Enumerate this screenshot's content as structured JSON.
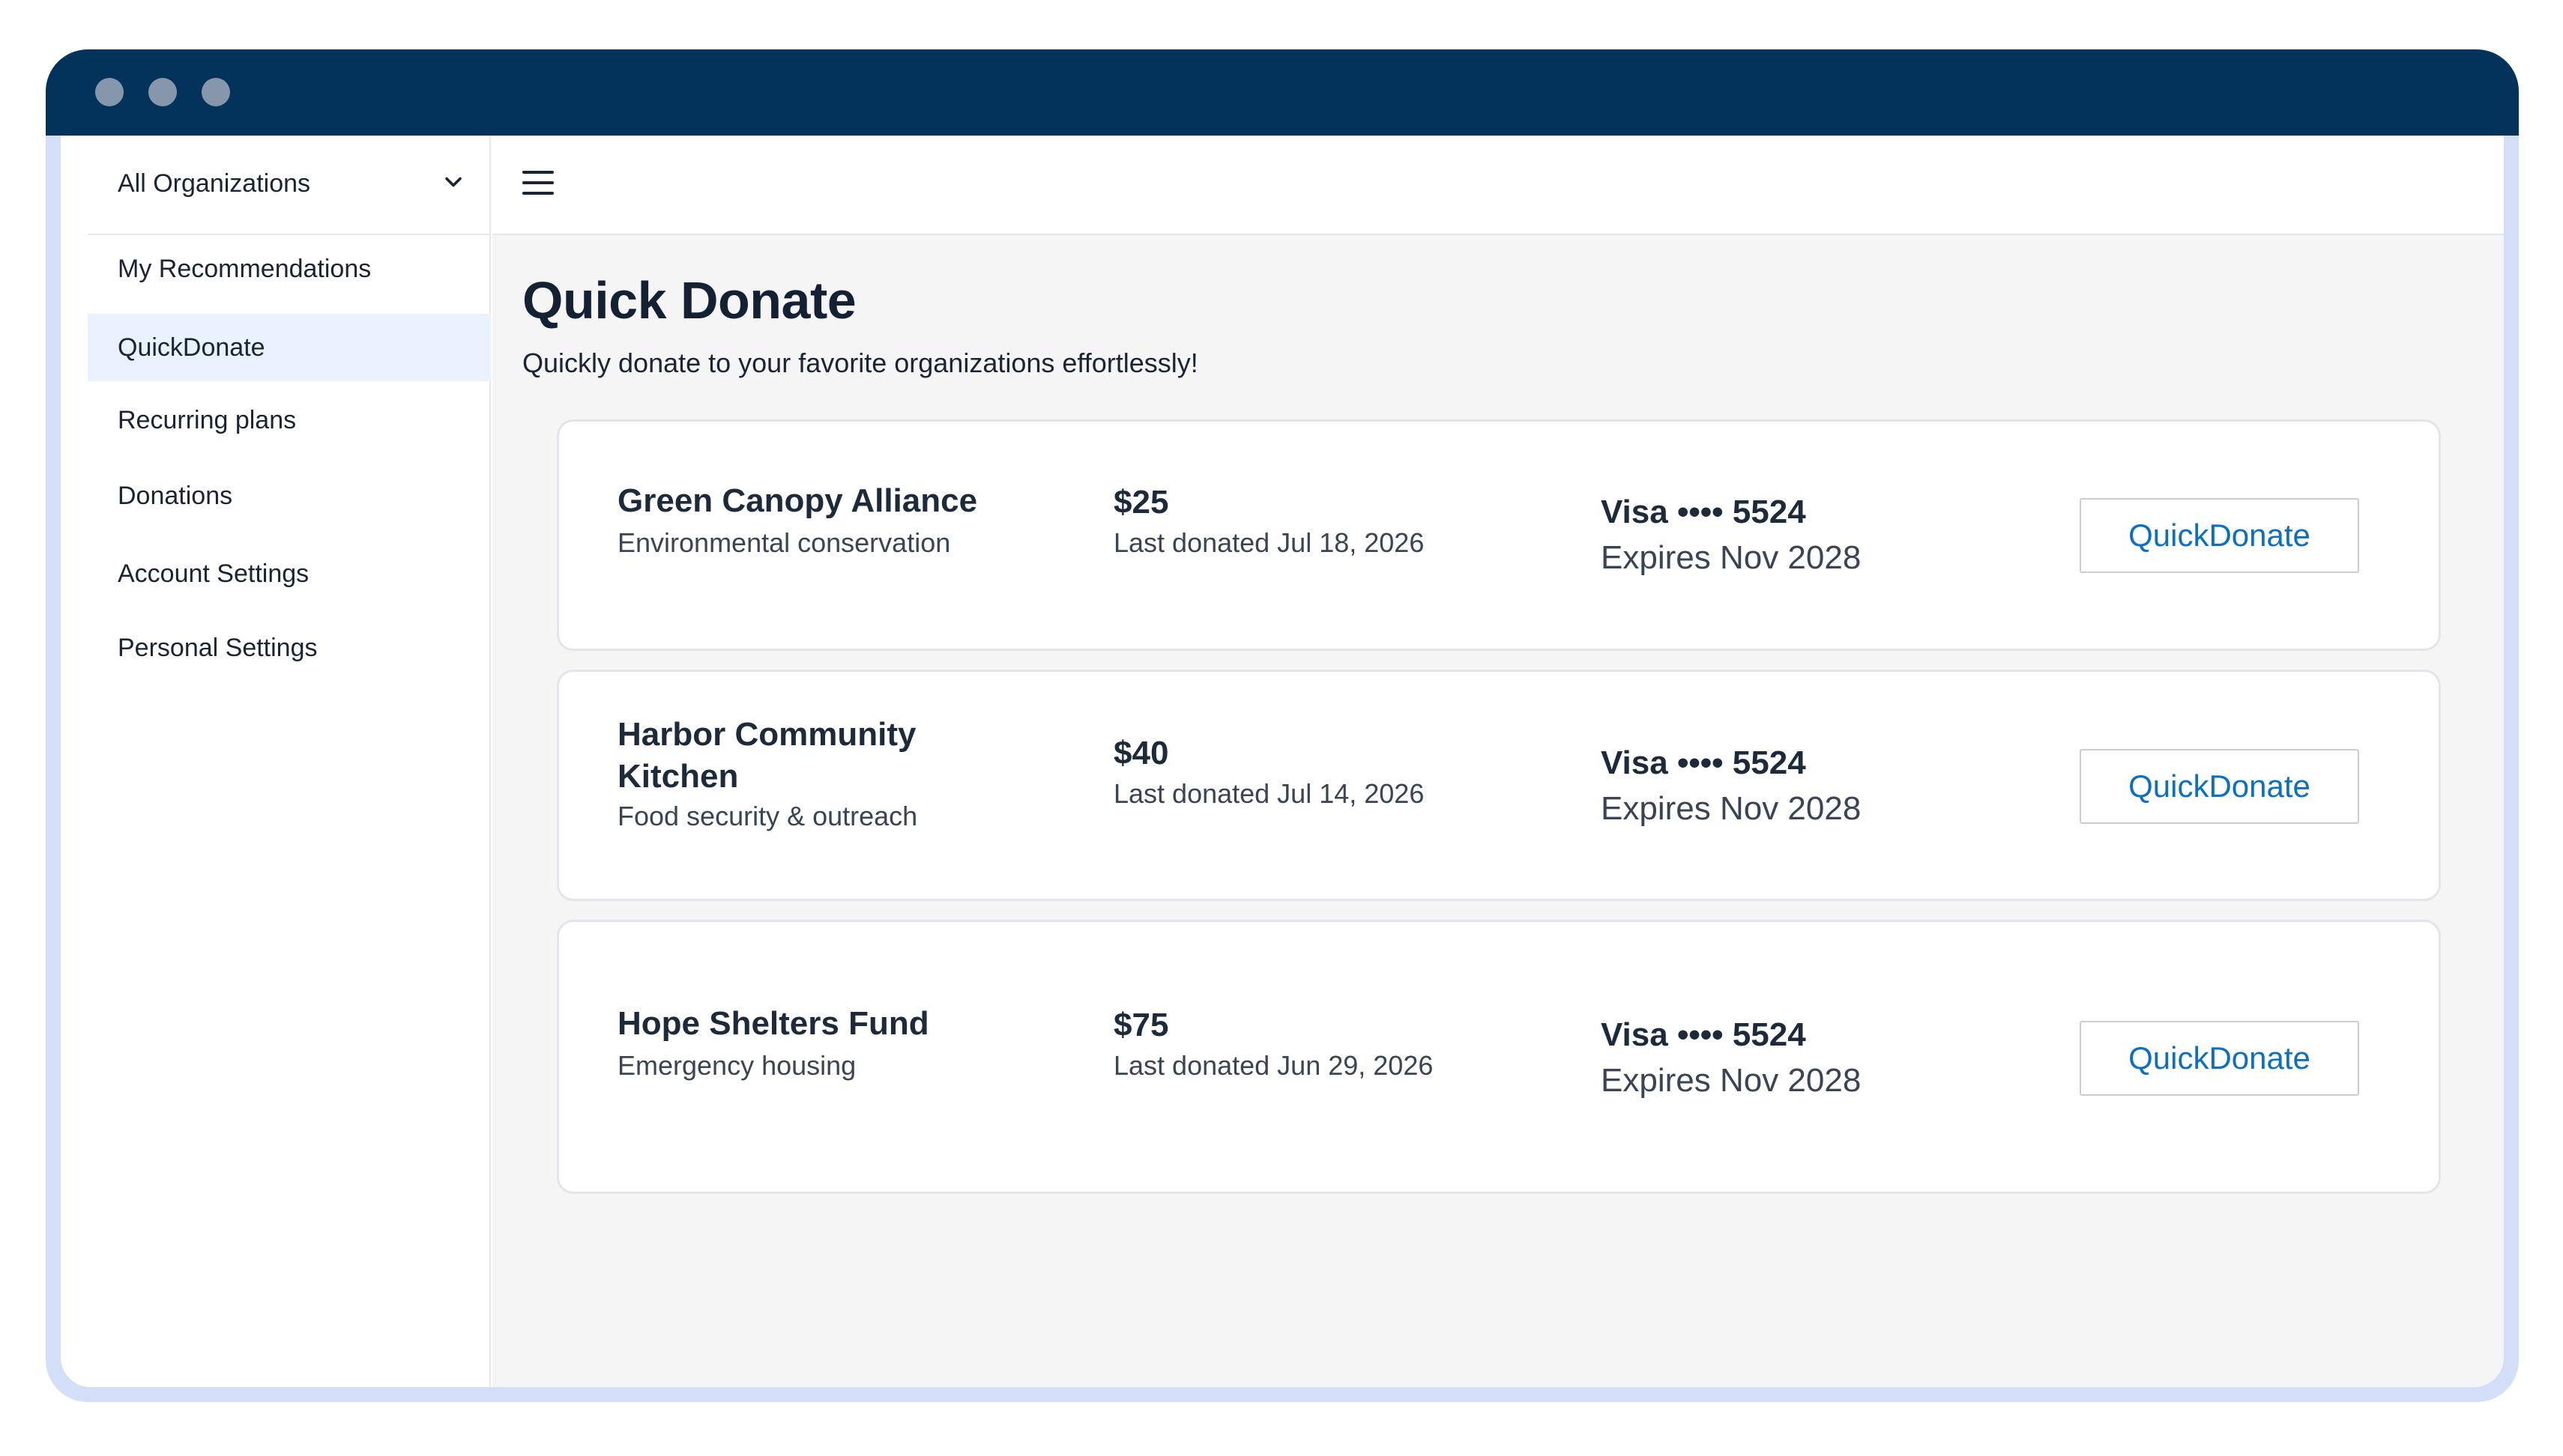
{
  "window": {
    "colors": {
      "titlebar": "#03325b",
      "frame": "#d3def8",
      "accent": "#0c6fc0",
      "active_nav": "#eaf1fe"
    }
  },
  "sidebar": {
    "org_select": {
      "value": "All Organizations",
      "icon": "chevron-down-icon"
    },
    "items": [
      {
        "label": "My Recommendations",
        "active": false
      },
      {
        "label": "QuickDonate",
        "active": true
      },
      {
        "label": "Recurring plans",
        "active": false
      },
      {
        "label": "Donations",
        "active": false
      },
      {
        "label": "Account Settings",
        "active": false
      },
      {
        "label": "Personal Settings",
        "active": false
      }
    ]
  },
  "header": {
    "menu_icon": "hamburger-menu-icon"
  },
  "main": {
    "title": "Quick Donate",
    "subtitle": "Quickly donate to your favorite organizations effortlessly!",
    "cards": [
      {
        "org_name": "Green Canopy Alliance",
        "category": "Environmental conservation",
        "amount": "$25",
        "last_donated": "Last donated Jul 18, 2026",
        "card": "Visa •••• 5524",
        "expires": "Expires Nov 2028",
        "button": "QuickDonate"
      },
      {
        "org_name": "Harbor Community Kitchen",
        "category": "Food security & outreach",
        "amount": "$40",
        "last_donated": "Last donated Jul 14, 2026",
        "card": "Visa •••• 5524",
        "expires": "Expires Nov 2028",
        "button": "QuickDonate"
      },
      {
        "org_name": "Hope Shelters Fund",
        "category": "Emergency housing",
        "amount": "$75",
        "last_donated": "Last donated Jun 29, 2026",
        "card": "Visa •••• 5524",
        "expires": "Expires Nov 2028",
        "button": "QuickDonate"
      }
    ]
  }
}
